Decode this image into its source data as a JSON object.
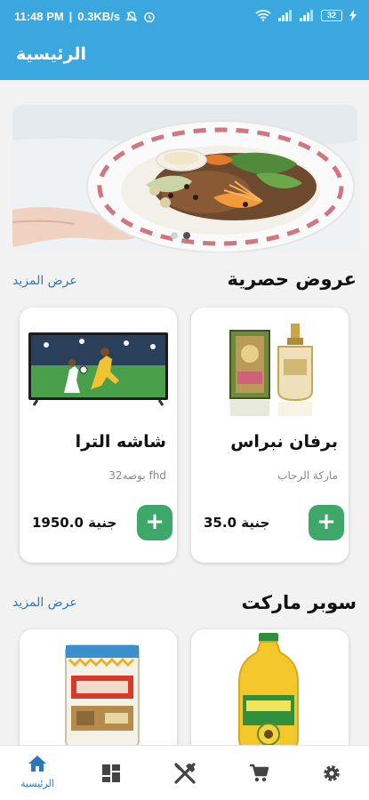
{
  "status": {
    "time": "11:48 PM",
    "speed": "0.3KB/s",
    "battery": "32"
  },
  "appbar": {
    "title": "الرئيسية"
  },
  "banner": {
    "slide_count": 2,
    "active_slide": 2
  },
  "exclusive": {
    "title": "عروض حصرية",
    "see_more": "عرض المزيد",
    "products": [
      {
        "name": "برفان نبراس",
        "subtitle": "ماركة الرحاب",
        "price": "35.0 جنية",
        "add_label": "+"
      },
      {
        "name": "شاشه الترا",
        "subtitle": "32بوصه fhd",
        "price": "1950.0 جنية",
        "add_label": "+"
      }
    ]
  },
  "supermarket": {
    "title": "سوبر ماركت",
    "see_more": "عرض المزيد",
    "products": [
      {
        "product": "sunflower-oil-bottle"
      },
      {
        "product": "rawak-ghee-tin"
      }
    ]
  },
  "bottom_nav": {
    "items": [
      {
        "icon": "home-icon",
        "label": "الرئيسية",
        "active": true
      },
      {
        "icon": "categories-icon",
        "label": "",
        "active": false
      },
      {
        "icon": "restaurant-icon",
        "label": "",
        "active": false
      },
      {
        "icon": "cart-icon",
        "label": "",
        "active": false
      },
      {
        "icon": "settings-icon",
        "label": "",
        "active": false
      }
    ]
  },
  "colors": {
    "primary": "#3aa8de",
    "link": "#2a79b8",
    "add_button": "#3da86a",
    "background": "#f2f2f2"
  }
}
